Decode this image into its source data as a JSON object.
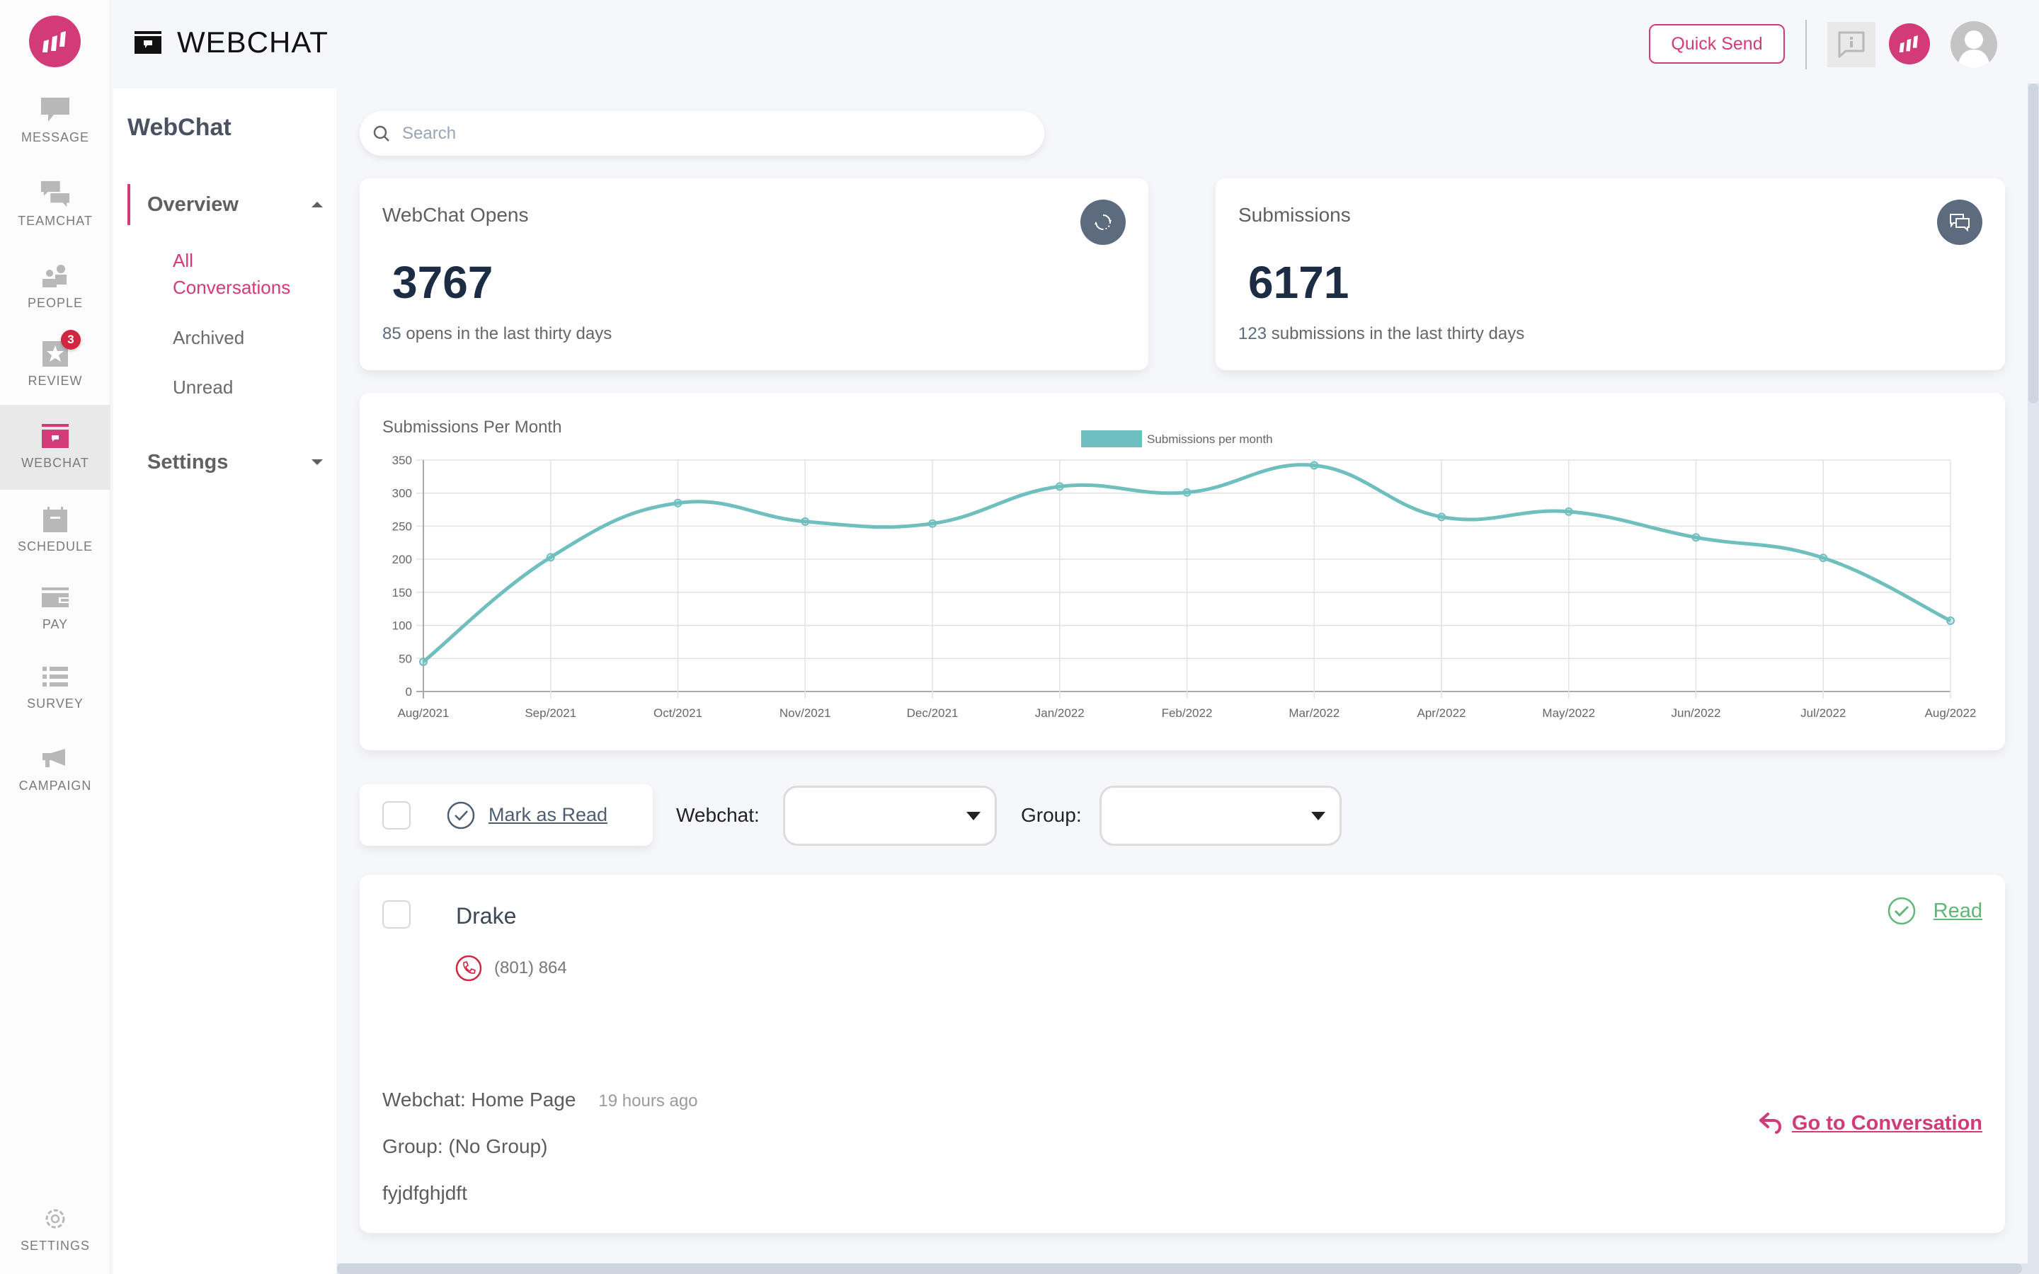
{
  "app": {
    "brand_color": "#d23a78",
    "accent_teal": "#6fbfbf"
  },
  "rail": {
    "items": [
      {
        "key": "message",
        "label": "MESSAGE",
        "icon": "message-icon"
      },
      {
        "key": "teamchat",
        "label": "TEAMCHAT",
        "icon": "teamchat-icon"
      },
      {
        "key": "people",
        "label": "PEOPLE",
        "icon": "people-icon"
      },
      {
        "key": "review",
        "label": "REVIEW",
        "icon": "review-star-icon",
        "badge": "3"
      },
      {
        "key": "webchat",
        "label": "WEBCHAT",
        "icon": "webchat-icon",
        "active": true
      },
      {
        "key": "schedule",
        "label": "SCHEDULE",
        "icon": "calendar-icon"
      },
      {
        "key": "pay",
        "label": "PAY",
        "icon": "wallet-icon"
      },
      {
        "key": "survey",
        "label": "SURVEY",
        "icon": "list-icon"
      },
      {
        "key": "campaign",
        "label": "CAMPAIGN",
        "icon": "megaphone-icon"
      },
      {
        "key": "settings",
        "label": "SETTINGS",
        "icon": "gear-icon"
      }
    ]
  },
  "header": {
    "title": "WEBCHAT",
    "quick_send": "Quick Send"
  },
  "subnav": {
    "title": "WebChat",
    "overview_label": "Overview",
    "links": [
      {
        "label": "All Conversations",
        "active": true
      },
      {
        "label": "Archived"
      },
      {
        "label": "Unread"
      }
    ],
    "settings_label": "Settings"
  },
  "search": {
    "placeholder": "Search",
    "value": ""
  },
  "stats": [
    {
      "title": "WebChat Opens",
      "value": "3767",
      "sub_num": "85",
      "sub_text": " opens in the last thirty days",
      "icon": "refresh-icon"
    },
    {
      "title": "Submissions",
      "value": "6171",
      "sub_num": "123",
      "sub_text": " submissions in the last thirty days",
      "icon": "chat-bubbles-icon"
    }
  ],
  "chart_data": {
    "type": "line",
    "title": "Submissions Per Month",
    "xlabel": "",
    "ylabel": "",
    "categories": [
      "Aug/2021",
      "Sep/2021",
      "Oct/2021",
      "Nov/2021",
      "Dec/2021",
      "Jan/2022",
      "Feb/2022",
      "Mar/2022",
      "Apr/2022",
      "May/2022",
      "Jun/2022",
      "Jul/2022",
      "Aug/2022"
    ],
    "series": [
      {
        "name": "Submissions per month",
        "color": "#6fbfbf",
        "values": [
          45,
          203,
          285,
          257,
          254,
          310,
          301,
          342,
          264,
          272,
          233,
          202,
          107
        ]
      }
    ],
    "ylim": [
      0,
      350
    ],
    "yticks": [
      0,
      50,
      100,
      150,
      200,
      250,
      300,
      350
    ],
    "grid": true,
    "legend": "top-center"
  },
  "filters": {
    "mark_as_read": "Mark as Read",
    "webchat_label": "Webchat:",
    "webchat_value": "",
    "group_label": "Group:",
    "group_value": ""
  },
  "conversation": {
    "name": "Drake",
    "phone": "(801) 864",
    "status": "Read",
    "source": "Webchat: Home Page",
    "time": "19 hours ago",
    "group": "Group: (No Group)",
    "message": "fyjdfghjdft",
    "goto": "Go to Conversation"
  }
}
